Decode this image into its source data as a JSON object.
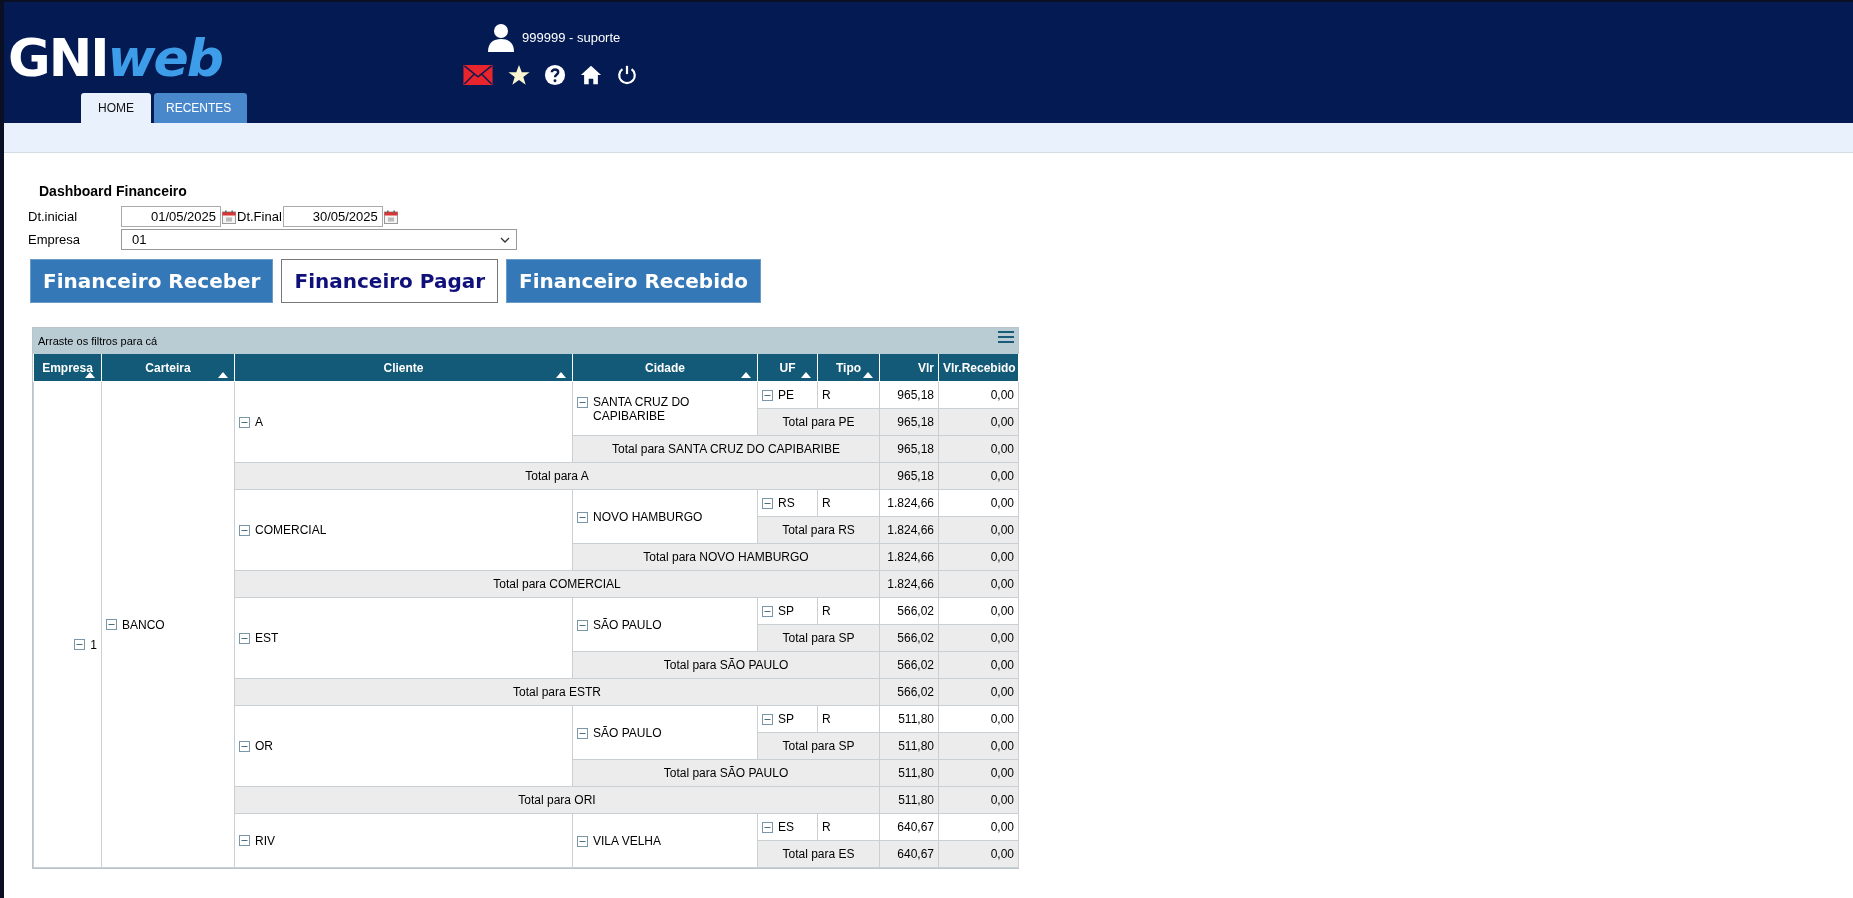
{
  "header": {
    "logo": {
      "part1": "GNI",
      "part2": "web"
    },
    "user": "999999 - suporte"
  },
  "tabs": [
    {
      "label": "HOME",
      "selected": true
    },
    {
      "label": "RECENTES",
      "selected": false
    }
  ],
  "form": {
    "title": "Dashboard Financeiro",
    "dt_inicial_label": "Dt.inicial",
    "dt_inicial": "01/05/2025",
    "dt_final_label": "Dt.Final",
    "dt_final": "30/05/2025",
    "empresa_label": "Empresa",
    "empresa": "01"
  },
  "buttons": [
    {
      "label": "Financeiro Receber",
      "selected": false
    },
    {
      "label": "Financeiro Pagar",
      "selected": true
    },
    {
      "label": "Financeiro Recebido",
      "selected": false
    }
  ],
  "pivot": {
    "filter_hint": "Arraste os filtros para cá",
    "columns": [
      {
        "label": "Empresa",
        "sortable": true
      },
      {
        "label": "Carteira",
        "sortable": true
      },
      {
        "label": "Cliente",
        "sortable": true
      },
      {
        "label": "Cidade",
        "sortable": true
      },
      {
        "label": "UF",
        "sortable": true
      },
      {
        "label": "Tipo",
        "sortable": true
      },
      {
        "label": "Vlr",
        "sortable": false
      },
      {
        "label": "Vlr.Recebido",
        "sortable": false
      }
    ],
    "empresa": {
      "name": "1",
      "expanded": true
    },
    "carteira": {
      "name": "BANCO",
      "expanded": true
    },
    "clients": [
      {
        "name": "A",
        "expanded": true,
        "cities": [
          {
            "name": "SANTA CRUZ DO CAPIBARIBE",
            "expanded": true,
            "ufs": [
              {
                "uf": "PE",
                "expanded": true,
                "tipo": "R",
                "vlr": "965,18",
                "recebido": "0,00",
                "total_label": "Total para PE",
                "total_vlr": "965,18",
                "total_recebido": "0,00"
              }
            ],
            "total": {
              "label": "Total para SANTA CRUZ DO CAPIBARIBE",
              "vlr": "965,18",
              "recebido": "0,00"
            }
          }
        ],
        "total": {
          "label": "Total para A",
          "vlr": "965,18",
          "recebido": "0,00"
        }
      },
      {
        "name": "COMERCIAL",
        "expanded": true,
        "cities": [
          {
            "name": "NOVO HAMBURGO",
            "expanded": true,
            "ufs": [
              {
                "uf": "RS",
                "expanded": true,
                "tipo": "R",
                "vlr": "1.824,66",
                "recebido": "0,00",
                "total_label": "Total para RS",
                "total_vlr": "1.824,66",
                "total_recebido": "0,00"
              }
            ],
            "total": {
              "label": "Total para NOVO HAMBURGO",
              "vlr": "1.824,66",
              "recebido": "0,00"
            }
          }
        ],
        "total": {
          "label": "Total para COMERCIAL",
          "vlr": "1.824,66",
          "recebido": "0,00"
        }
      },
      {
        "name": "EST",
        "expanded": true,
        "cities": [
          {
            "name": "SÃO PAULO",
            "expanded": true,
            "ufs": [
              {
                "uf": "SP",
                "expanded": true,
                "tipo": "R",
                "vlr": "566,02",
                "recebido": "0,00",
                "total_label": "Total para SP",
                "total_vlr": "566,02",
                "total_recebido": "0,00"
              }
            ],
            "total": {
              "label": "Total para SÃO PAULO",
              "vlr": "566,02",
              "recebido": "0,00"
            }
          }
        ],
        "total": {
          "label": "Total para ESTR",
          "vlr": "566,02",
          "recebido": "0,00"
        }
      },
      {
        "name": "OR",
        "expanded": true,
        "cities": [
          {
            "name": "SÃO PAULO",
            "expanded": true,
            "ufs": [
              {
                "uf": "SP",
                "expanded": true,
                "tipo": "R",
                "vlr": "511,80",
                "recebido": "0,00",
                "total_label": "Total para SP",
                "total_vlr": "511,80",
                "total_recebido": "0,00"
              }
            ],
            "total": {
              "label": "Total para SÃO PAULO",
              "vlr": "511,80",
              "recebido": "0,00"
            }
          }
        ],
        "total": {
          "label": "Total para ORI",
          "vlr": "511,80",
          "recebido": "0,00"
        }
      },
      {
        "name": "RIV",
        "expanded": true,
        "cities": [
          {
            "name": "VILA VELHA",
            "expanded": true,
            "ufs": [
              {
                "uf": "ES",
                "expanded": true,
                "tipo": "R",
                "vlr": "640,67",
                "recebido": "0,00",
                "total_label": "Total para ES",
                "total_vlr": "640,67",
                "total_recebido": "0,00"
              }
            ]
          }
        ]
      }
    ]
  }
}
